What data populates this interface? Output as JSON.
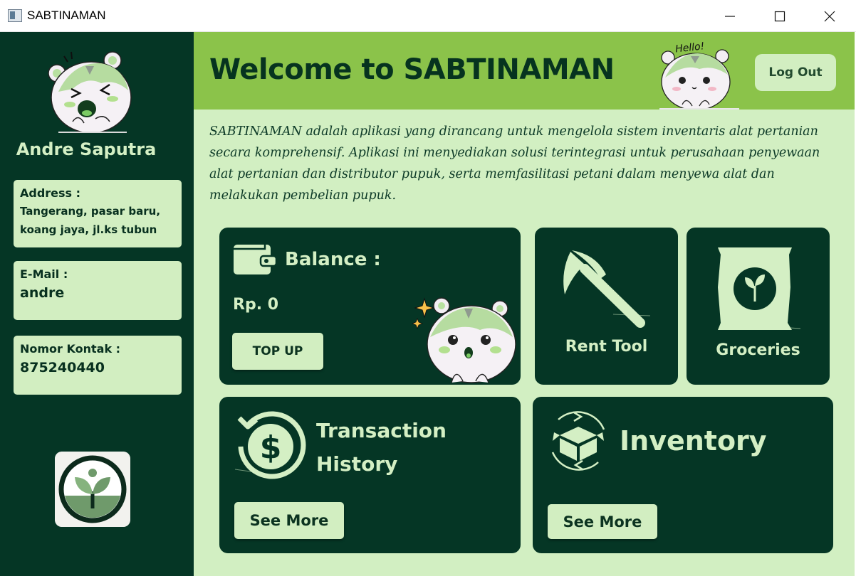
{
  "window": {
    "title": "SABTINAMAN",
    "minimize": "─",
    "maximize": "☐",
    "close": "✕"
  },
  "icons": {
    "app": "app-window-icon",
    "avatar": "hamster-mascot-icon",
    "logo": "sprout-logo-icon",
    "hello_mascot": "hello-hamster-icon",
    "wallet": "wallet-icon",
    "rent": "scythe-icon",
    "groceries": "fertilizer-bag-icon",
    "history": "dollar-history-icon",
    "inventory": "box-refresh-icon"
  },
  "colors": {
    "sidebar": "#053625",
    "header": "#8bc34a",
    "background": "#d2efc2",
    "card": "#053625",
    "accent_light": "#d2eec1",
    "text_dark": "#06331f"
  },
  "sidebar": {
    "user_name": "Andre Saputra",
    "address_label": "Address :",
    "address_value": "Tangerang, pasar baru, koang jaya, jl.ks tubun",
    "email_label": "E-Mail :",
    "email_value": "andre",
    "contact_label": "Nomor Kontak :",
    "contact_value": "875240440"
  },
  "header": {
    "welcome": "Welcome to SABTINAMAN",
    "hello_text": "Hello!",
    "logout": "Log Out"
  },
  "main": {
    "description": "SABTINAMAN adalah aplikasi yang dirancang untuk mengelola sistem inventaris alat pertanian secara komprehensif. Aplikasi ini menyediakan solusi terintegrasi untuk perusahaan penyewaan alat pertanian dan distributor pupuk, serta memfasilitasi petani dalam menyewa alat dan melakukan pembelian pupuk.",
    "balance_label": "Balance :",
    "balance_amount": "Rp. 0",
    "topup": "TOP UP",
    "rent_tool": "Rent Tool",
    "groceries": "Groceries",
    "history_line1": "Transaction",
    "history_line2": "History",
    "history_button": "See More",
    "inventory": "Inventory",
    "inventory_button": "See More"
  }
}
